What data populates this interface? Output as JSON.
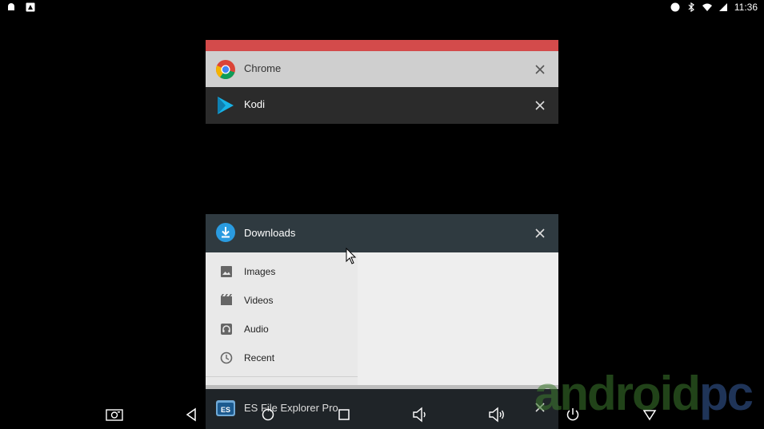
{
  "status_bar": {
    "time": "11:36"
  },
  "recents": {
    "chrome": {
      "title": "Chrome"
    },
    "kodi": {
      "title": "Kodi"
    },
    "downloads": {
      "title": "Downloads",
      "menu": [
        {
          "label": "Images",
          "icon": "image-icon"
        },
        {
          "label": "Videos",
          "icon": "video-icon"
        },
        {
          "label": "Audio",
          "icon": "audio-icon"
        },
        {
          "label": "Recent",
          "icon": "clock-icon"
        }
      ]
    },
    "es_file": {
      "title": "ES File Explorer Pro"
    }
  },
  "watermark": {
    "part1": "android",
    "part2": "pc"
  },
  "colors": {
    "chrome_header": "#cfcfcf",
    "chrome_top": "#d34b4b",
    "kodi_header": "#2b2b2b",
    "downloads_header": "#2f3a40",
    "downloads_accent": "#2a9be0",
    "panel_bg": "#eeeeee"
  }
}
